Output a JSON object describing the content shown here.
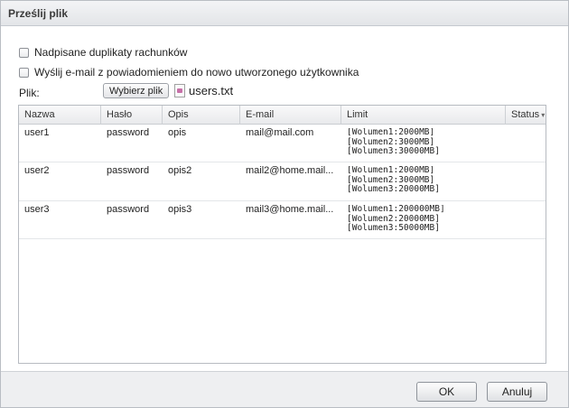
{
  "dialog": {
    "title": "Prześlij plik"
  },
  "options": [
    {
      "label": "Nadpisane duplikaty rachunków",
      "checked": false
    },
    {
      "label": "Wyślij e-mail z powiadomieniem do nowo utworzonego użytkownika",
      "checked": false
    }
  ],
  "file": {
    "label": "Plik:",
    "choose_button": "Wybierz plik",
    "selected_file": "users.txt"
  },
  "table": {
    "columns": [
      "Nazwa",
      "Hasło",
      "Opis",
      "E-mail",
      "Limit",
      "Status"
    ],
    "rows": [
      {
        "name": "user1",
        "password": "password",
        "desc": "opis",
        "email": "mail@mail.com",
        "limit": [
          "[Wolumen1:2000MB]",
          "[Wolumen2:3000MB]",
          "[Wolumen3:30000MB]"
        ],
        "status": ""
      },
      {
        "name": "user2",
        "password": "password",
        "desc": "opis2",
        "email": "mail2@home.mail...",
        "limit": [
          "[Wolumen1:2000MB]",
          "[Wolumen2:3000MB]",
          "[Wolumen3:20000MB]"
        ],
        "status": ""
      },
      {
        "name": "user3",
        "password": "password",
        "desc": "opis3",
        "email": "mail3@home.mail...",
        "limit": [
          "[Wolumen1:200000MB]",
          "[Wolumen2:20000MB]",
          "[Wolumen3:50000MB]"
        ],
        "status": ""
      }
    ]
  },
  "footer": {
    "ok": "OK",
    "cancel": "Anuluj"
  }
}
